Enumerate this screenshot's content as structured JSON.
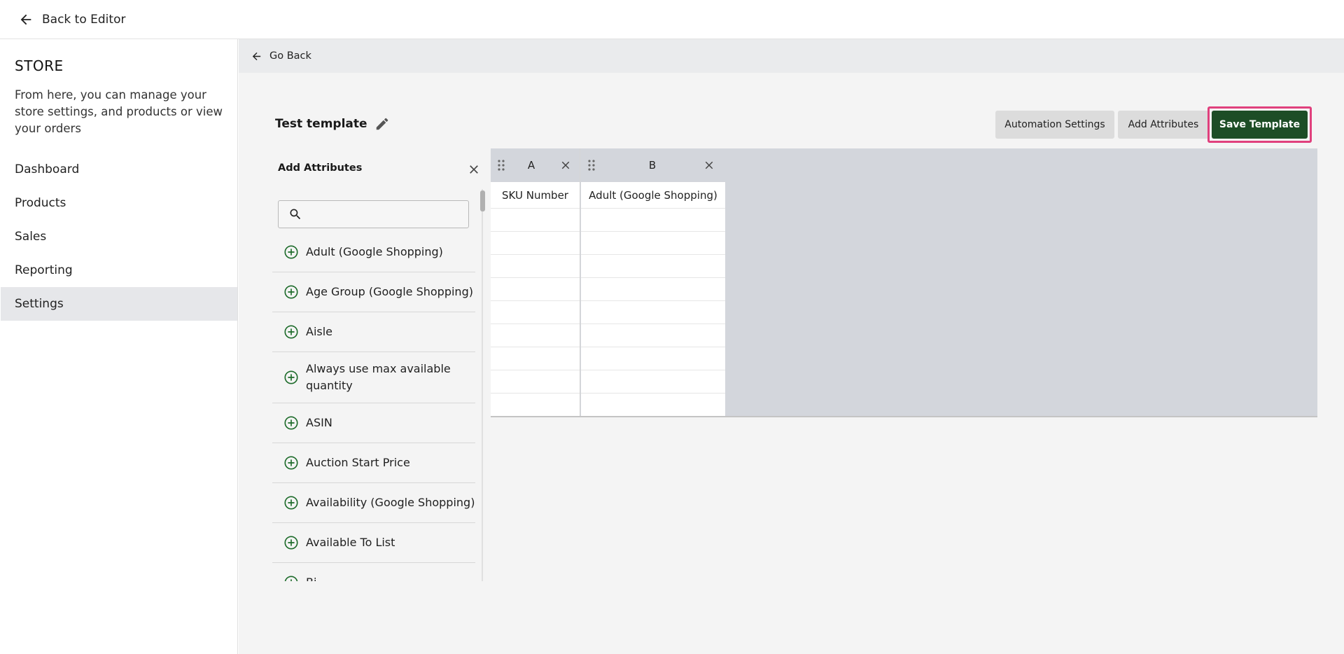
{
  "topbar": {
    "back_label": "Back to Editor",
    "back_icon": "arrow-left-icon"
  },
  "sidebar": {
    "title": "STORE",
    "description": "From here, you can manage your store settings, and products or view your orders",
    "items": [
      {
        "label": "Dashboard",
        "active": false
      },
      {
        "label": "Products",
        "active": false
      },
      {
        "label": "Sales",
        "active": false
      },
      {
        "label": "Reporting",
        "active": false
      },
      {
        "label": "Settings",
        "active": true
      }
    ]
  },
  "main": {
    "goback_label": "Go Back",
    "template_name": "Test template",
    "buttons": {
      "automation": "Automation Settings",
      "add_attributes": "Add Attributes",
      "save": "Save Template"
    },
    "colors": {
      "save_bg": "#1d4d26",
      "highlight": "#e0407d",
      "add_icon": "#1d6b2a"
    }
  },
  "attributes_panel": {
    "title": "Add Attributes",
    "search_placeholder": "",
    "items": [
      "Adult (Google Shopping)",
      "Age Group (Google Shopping)",
      "Aisle",
      "Always use max available quantity",
      "ASIN",
      "Auction Start Price",
      "Availability (Google Shopping)",
      "Available To List",
      "Bi"
    ]
  },
  "grid": {
    "columns": [
      {
        "letter": "A",
        "header": "SKU Number"
      },
      {
        "letter": "B",
        "header": "Adult (Google Shopping)"
      }
    ]
  }
}
